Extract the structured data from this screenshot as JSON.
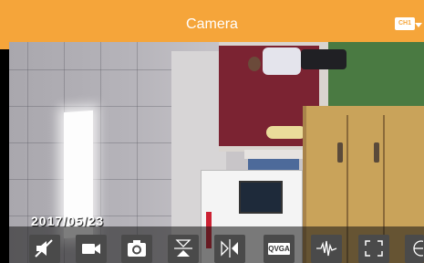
{
  "header": {
    "title": "Camera",
    "channel_badge": "CH1"
  },
  "video": {
    "timestamp": "2017/05/23"
  },
  "toolbar": {
    "quality_label": "QVGA"
  },
  "colors": {
    "accent": "#f5a53a",
    "toolbar_button": "#4a4a4a"
  }
}
